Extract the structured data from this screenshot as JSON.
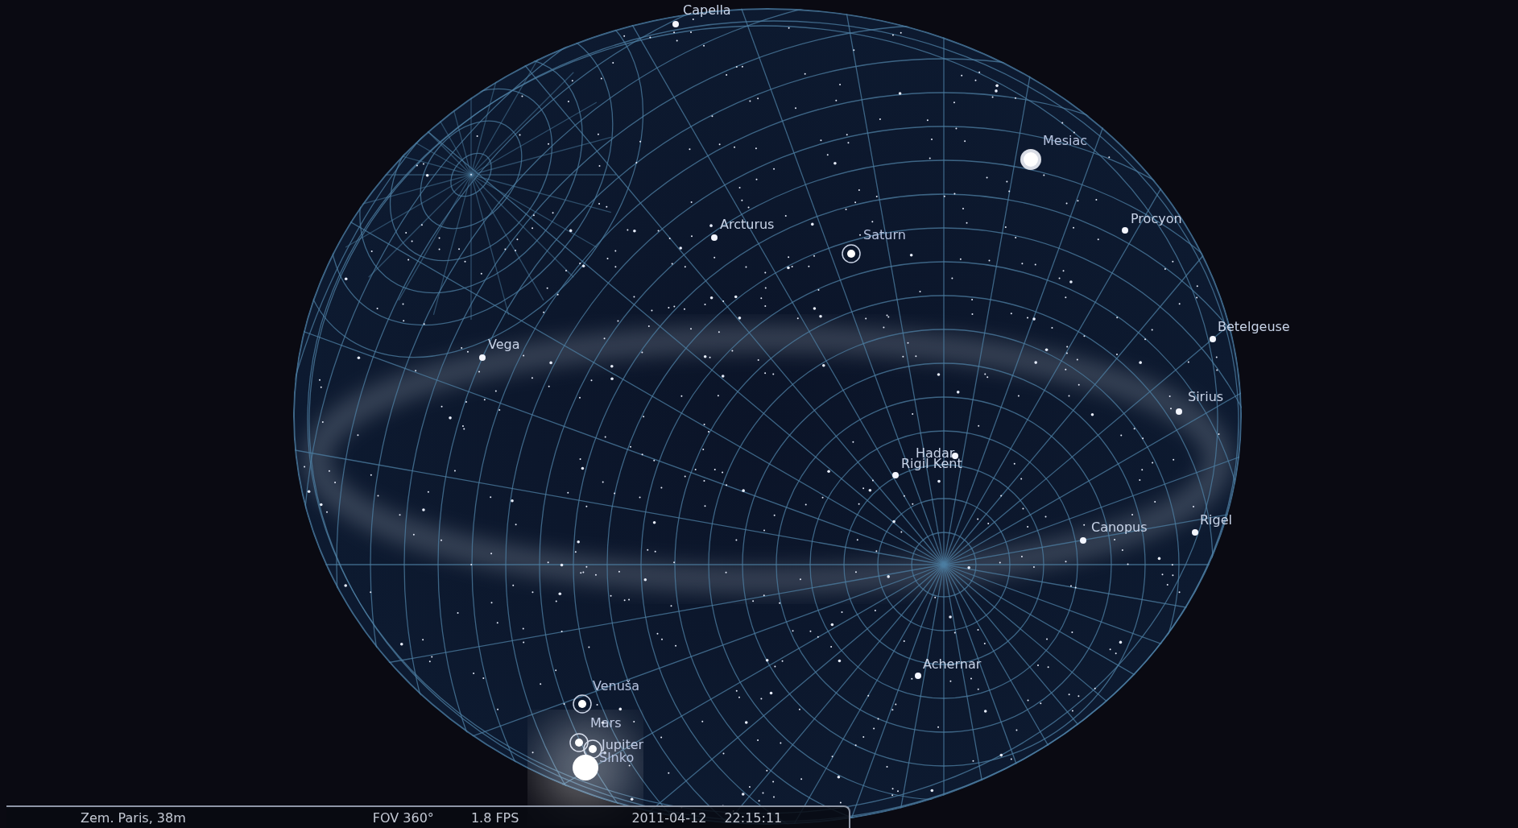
{
  "sky": {
    "objects": [
      {
        "name": "Capella",
        "kind": "star"
      },
      {
        "name": "Mesiac",
        "kind": "moon"
      },
      {
        "name": "Procyon",
        "kind": "star"
      },
      {
        "name": "Arcturus",
        "kind": "star"
      },
      {
        "name": "Saturn",
        "kind": "planet"
      },
      {
        "name": "Betelgeuse",
        "kind": "star"
      },
      {
        "name": "Vega",
        "kind": "star"
      },
      {
        "name": "Sirius",
        "kind": "star"
      },
      {
        "name": "Hadar",
        "kind": "star"
      },
      {
        "name": "Rigil Kent",
        "kind": "star"
      },
      {
        "name": "Canopus",
        "kind": "star"
      },
      {
        "name": "Rigel",
        "kind": "star"
      },
      {
        "name": "Achernar",
        "kind": "star"
      },
      {
        "name": "Venuša",
        "kind": "planet"
      },
      {
        "name": "Mars",
        "kind": "planet"
      },
      {
        "name": "Jupiter",
        "kind": "planet"
      },
      {
        "name": "Slnko",
        "kind": "sun"
      }
    ]
  },
  "status_bar": {
    "location": "Zem. Paris, 38m",
    "fov": "FOV 360°",
    "fps": "1.8 FPS",
    "date": "2011-04-12",
    "time": "22:15:11"
  }
}
